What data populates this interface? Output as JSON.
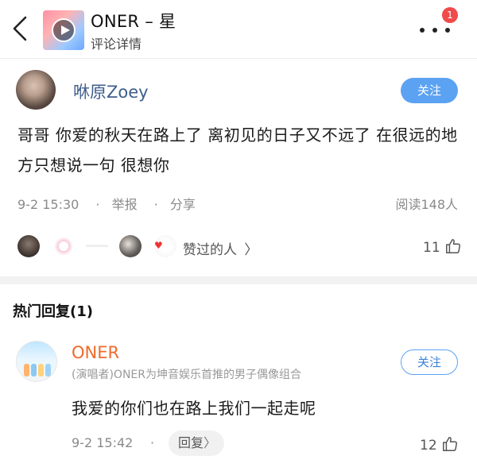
{
  "header": {
    "title": "ONER – 星",
    "subtitle": "评论详情",
    "notification_count": "1"
  },
  "comment": {
    "username": "咻原Zoey",
    "follow_label": "关注",
    "text": "哥哥 你爱的秋天在路上了 离初见的日子又不远了 在很远的地方只想说一句 很想你",
    "time": "9-2 15:30",
    "report_label": "举报",
    "share_label": "分享",
    "reads": "阅读148人",
    "liked_by_label": "赞过的人",
    "like_count": "11"
  },
  "hot_replies": {
    "title": "热门回复(1)",
    "items": [
      {
        "username": "ONER",
        "tag": "(演唱者)ONER为坤音娱乐首推的男子偶像组合",
        "follow_label": "关注",
        "text": "我爱的你们也在路上我们一起走呢",
        "time": "9-2 15:42",
        "reply_label": "回复",
        "like_count": "12"
      }
    ]
  },
  "colors": {
    "accent_blue": "#5ba2f2",
    "username_blue": "#3f5e8c",
    "reply_orange": "#f06a2a",
    "badge_red": "#f04a4a"
  },
  "icons": [
    "back-icon",
    "play-icon",
    "more-icon",
    "chevron-right-icon",
    "thumb-up-icon"
  ]
}
